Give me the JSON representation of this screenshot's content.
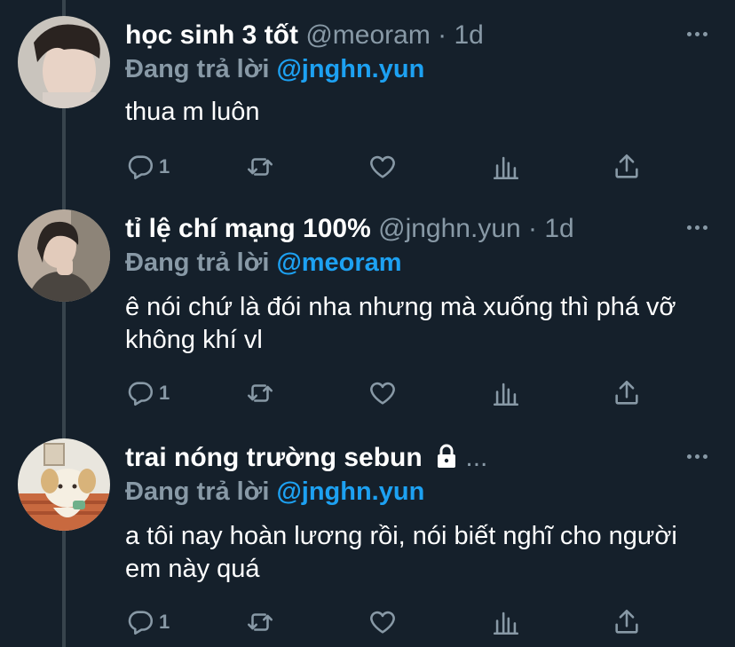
{
  "colors": {
    "background": "#15202b",
    "secondary_text": "#8899a6",
    "link": "#1da1f2"
  },
  "tweets": [
    {
      "display_name": "học sinh 3 tốt",
      "meta": "@meoram · 1d",
      "reply_prefix": "Đang trả lời",
      "reply_to": "@jnghn.yun",
      "text": "thua m luôn",
      "reply_count": "1",
      "locked": false
    },
    {
      "display_name": "tỉ lệ chí mạng 100%",
      "meta": "@jnghn.yun · 1d",
      "reply_prefix": "Đang trả lời",
      "reply_to": "@meoram",
      "text": "ê nói chứ là đói nha nhưng mà xuống thì phá vỡ không khí vl",
      "reply_count": "1",
      "locked": false
    },
    {
      "display_name": "trai nóng trường sebun",
      "meta": "...",
      "reply_prefix": "Đang trả lời",
      "reply_to": "@jnghn.yun",
      "text": "a tôi nay hoàn lương rồi, nói biết nghĩ cho người em này quá",
      "reply_count": "1",
      "locked": true
    }
  ]
}
